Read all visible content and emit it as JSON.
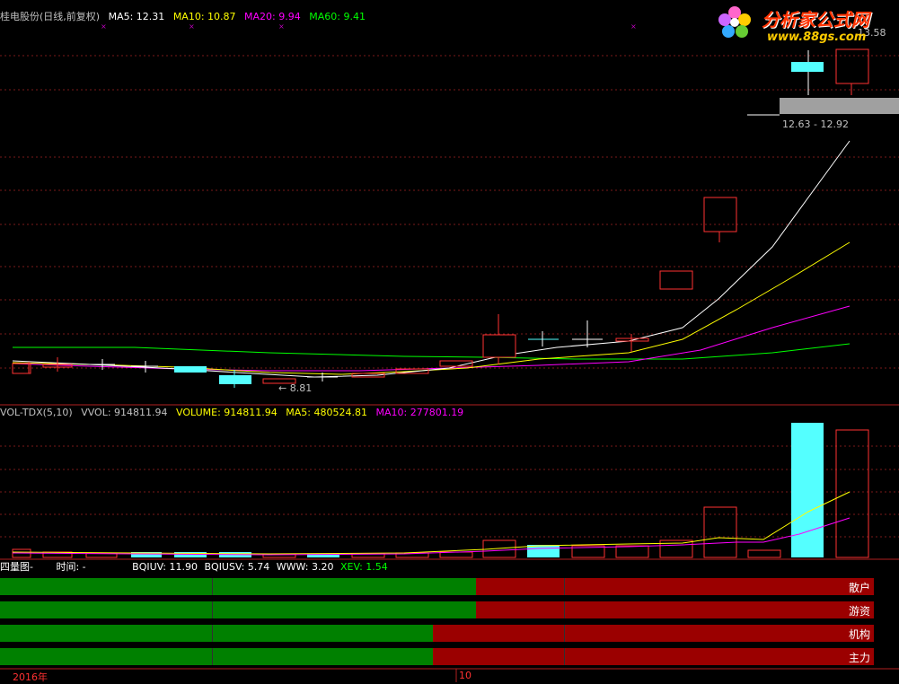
{
  "kline": {
    "stock_title": "桂电股份(日线,前复权)",
    "ma5": "MA5: 12.31",
    "ma10": "MA10: 10.87",
    "ma20": "MA20: 9.94",
    "ma60": "MA60: 9.41",
    "low_marker": "← 8.81",
    "high_marker": "13.58",
    "range_label": "12.63 - 12.92",
    "colors": {
      "ma5": "#ffffff",
      "ma10": "#ffff00",
      "ma20": "#ff00ff",
      "ma60": "#00ff00",
      "up": "#ff3232",
      "down": "#54ffff"
    }
  },
  "volume": {
    "indicator": "VOL-TDX(5,10)",
    "vvol": "VVOL: 914811.94",
    "volume": "VOLUME: 914811.94",
    "ma5": "MA5: 480524.81",
    "ma10": "MA10: 277801.19"
  },
  "bottom": {
    "panel_name": "四量图-",
    "time_label": "时间: -",
    "bqiuv": "BQIUV: 11.90",
    "bqiusv": "BQIUSV: 5.74",
    "www": "WWW: 3.20",
    "xev": "XEV: 1.54",
    "bars": [
      {
        "label": "散户",
        "green_fraction": 0.545
      },
      {
        "label": "游资",
        "green_fraction": 0.545
      },
      {
        "label": "机构",
        "green_fraction": 0.495
      },
      {
        "label": "主力",
        "green_fraction": 0.495
      }
    ]
  },
  "axis": {
    "year_label": "2016年",
    "month_label": "10"
  },
  "logo": {
    "title": "分析家公式网",
    "url": "www.88gs.com"
  }
}
